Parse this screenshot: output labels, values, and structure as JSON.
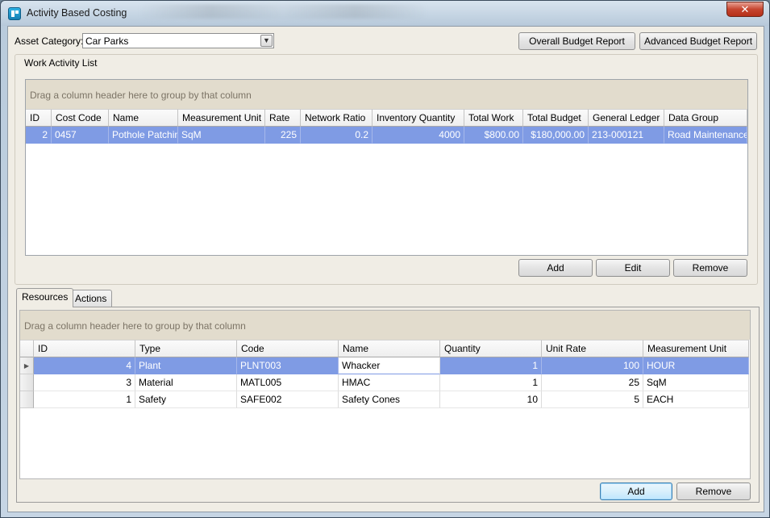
{
  "window": {
    "title": "Activity Based Costing",
    "close_label": "✕"
  },
  "filter": {
    "label": "Asset Category:",
    "value": "Car Parks"
  },
  "reports": {
    "overall": "Overall Budget Report",
    "advanced": "Advanced Budget Report"
  },
  "work_activity": {
    "title": "Work Activity List",
    "group_hint": "Drag a column header here to group by that column",
    "columns": [
      "ID",
      "Cost Code",
      "Name",
      "Measurement Unit",
      "Rate",
      "Network Ratio",
      "Inventory Quantity",
      "Total Work",
      "Total Budget",
      "General Ledger",
      "Data Group"
    ],
    "rows": [
      [
        "2",
        "0457",
        "Pothole Patching",
        "SqM",
        "225",
        "0.2",
        "4000",
        "$800.00",
        "$180,000.00",
        "213-000121",
        "Road Maintenance"
      ]
    ],
    "buttons": {
      "add": "Add",
      "edit": "Edit",
      "remove": "Remove"
    }
  },
  "tabs": [
    {
      "label": "Resources"
    },
    {
      "label": "Actions"
    }
  ],
  "resources": {
    "group_hint": "Drag a column header here to group by that column",
    "columns": [
      "ID",
      "Type",
      "Code",
      "Name",
      "Quantity",
      "Unit Rate",
      "Measurement Unit"
    ],
    "rows": [
      [
        "4",
        "Plant",
        "PLNT003",
        "Whacker",
        "1",
        "100",
        "HOUR"
      ],
      [
        "3",
        "Material",
        "MATL005",
        "HMAC",
        "1",
        "25",
        "SqM"
      ],
      [
        "1",
        "Safety",
        "SAFE002",
        "Safety Cones",
        "10",
        "5",
        "EACH"
      ]
    ],
    "buttons": {
      "add": "Add",
      "remove": "Remove"
    }
  }
}
